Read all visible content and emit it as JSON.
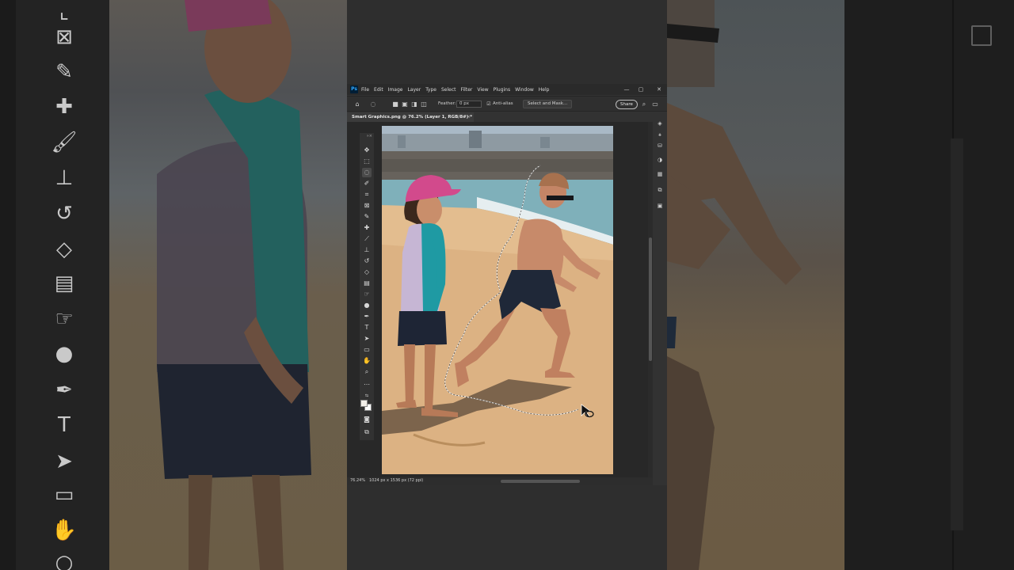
{
  "app": {
    "menu": [
      "File",
      "Edit",
      "Image",
      "Layer",
      "Type",
      "Select",
      "Filter",
      "View",
      "Plugins",
      "Window",
      "Help"
    ],
    "logo": "Ps",
    "window_controls": [
      "—",
      "▢",
      "✕"
    ]
  },
  "options": {
    "feather_label": "Feather:",
    "feather_value": "0 px",
    "antialias_label": "Anti-alias",
    "select_mask_label": "Select and Mask...",
    "share_label": "Share"
  },
  "document": {
    "tab_title": "Smart Graphics.png @ 76.2% (Layer 1, RGB/8#) *",
    "tab_close": "×"
  },
  "status": {
    "zoom": "76.24%",
    "dimensions": "1024 px x 1536 px (72 ppi)"
  },
  "tools": [
    "move-icon",
    "marquee-icon",
    "lasso-icon",
    "quick-select-icon",
    "crop-icon",
    "frame-icon",
    "eyedropper-icon",
    "healing-icon",
    "brush-icon",
    "stamp-icon",
    "history-brush-icon",
    "eraser-icon",
    "gradient-icon",
    "smudge-icon",
    "dodge-icon",
    "pen-icon",
    "type-icon",
    "path-select-icon",
    "rectangle-icon",
    "hand-icon",
    "zoom-icon",
    "more-icon"
  ],
  "colors": {
    "foreground": "#f2efe9",
    "background": "#ffffff",
    "accent": "#31a8ff"
  }
}
